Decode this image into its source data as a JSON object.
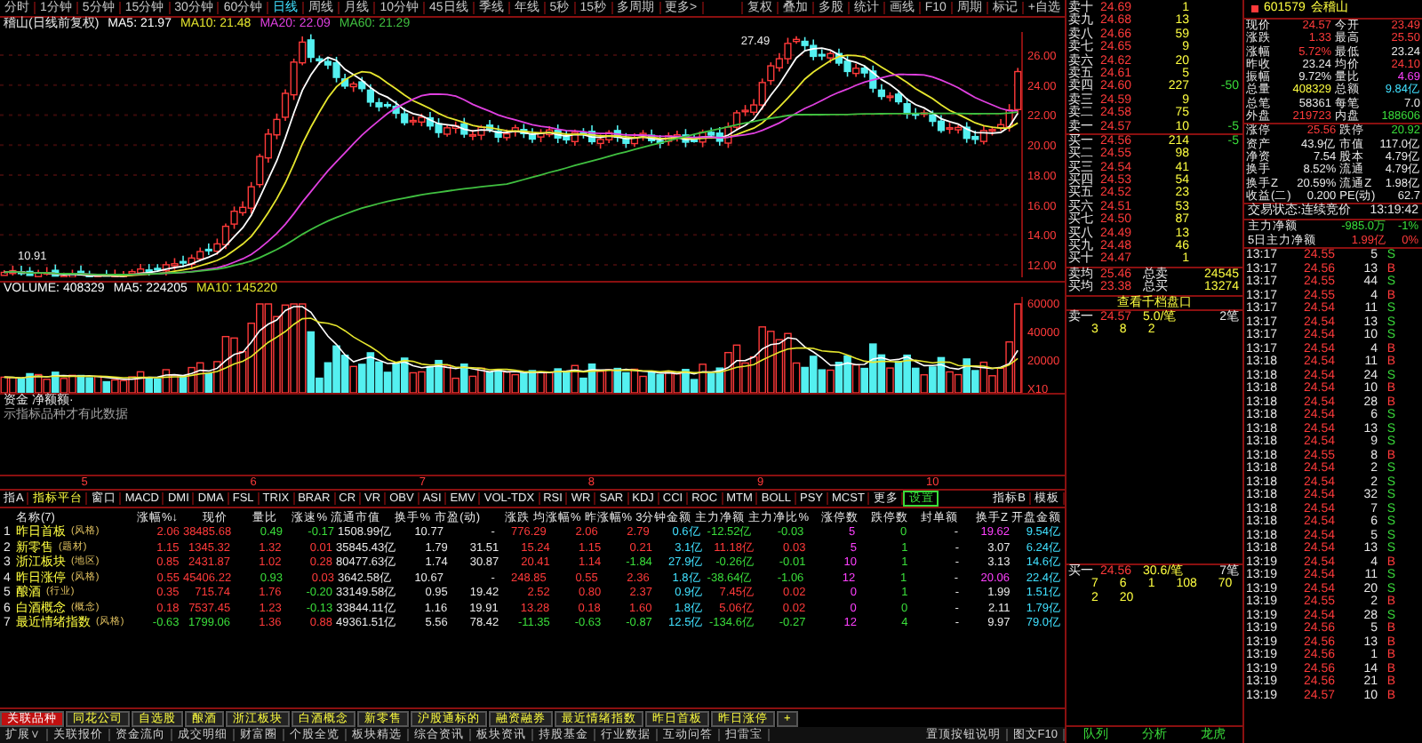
{
  "chart_toolbar": {
    "periods": [
      {
        "label": "分时",
        "selected": false
      },
      {
        "label": "1分钟",
        "selected": false
      },
      {
        "label": "5分钟",
        "selected": false
      },
      {
        "label": "15分钟",
        "selected": false
      },
      {
        "label": "30分钟",
        "selected": false
      },
      {
        "label": "60分钟",
        "selected": false
      },
      {
        "label": "日线",
        "selected": true
      },
      {
        "label": "周线",
        "selected": false
      },
      {
        "label": "月线",
        "selected": false
      },
      {
        "label": "10分钟",
        "selected": false
      },
      {
        "label": "45日线",
        "selected": false
      },
      {
        "label": "季线",
        "selected": false
      },
      {
        "label": "年线",
        "selected": false
      },
      {
        "label": "5秒",
        "selected": false
      },
      {
        "label": "15秒",
        "selected": false
      },
      {
        "label": "多周期",
        "selected": false
      },
      {
        "label": "更多>",
        "selected": false
      }
    ],
    "tools": [
      "复权",
      "叠加",
      "多股",
      "统计",
      "画线",
      "F10",
      "周期",
      "标记",
      "+自选"
    ]
  },
  "chart": {
    "title": "稽山(日线前复权)",
    "legend": [
      {
        "label": "MA5: 21.97",
        "color": "#ffffff"
      },
      {
        "label": "MA10: 21.48",
        "color": "#e6e62e"
      },
      {
        "label": "MA20: 22.09",
        "color": "#e040e0"
      },
      {
        "label": "MA60: 21.29",
        "color": "#40c040"
      }
    ],
    "high_label": "27.49",
    "low_label": "10.91",
    "price_ticks": [
      "26.00",
      "24.00",
      "22.00",
      "20.00",
      "18.00",
      "16.00",
      "14.00",
      "12.00"
    ]
  },
  "volume": {
    "legend": [
      {
        "label": "VOLUME: 408329",
        "color": "#ffffff"
      },
      {
        "label": "MA5: 224205",
        "color": "#ffffff"
      },
      {
        "label": "MA10: 145220",
        "color": "#e6e62e"
      }
    ],
    "ticks": [
      "60000",
      "40000",
      "20000",
      "X10"
    ]
  },
  "fund_panel": {
    "title": "资金 净额额·",
    "note": "示指标品种才有此数据"
  },
  "month_axis": [
    "5",
    "6",
    "7",
    "8",
    "9",
    "10"
  ],
  "indicator_tabs": [
    {
      "label": "指A",
      "kind": "plain",
      "selected": false
    },
    {
      "label": "指标平台",
      "kind": "accent",
      "selected": false
    },
    {
      "label": "窗口",
      "kind": "plain",
      "selected": false
    },
    {
      "label": "MACD",
      "kind": "plain",
      "selected": false
    },
    {
      "label": "DMI",
      "kind": "plain",
      "selected": false
    },
    {
      "label": "DMA",
      "kind": "plain",
      "selected": false
    },
    {
      "label": "FSL",
      "kind": "plain",
      "selected": false
    },
    {
      "label": "TRIX",
      "kind": "plain",
      "selected": false
    },
    {
      "label": "BRAR",
      "kind": "plain",
      "selected": false
    },
    {
      "label": "CR",
      "kind": "plain",
      "selected": false
    },
    {
      "label": "VR",
      "kind": "plain",
      "selected": false
    },
    {
      "label": "OBV",
      "kind": "plain",
      "selected": false
    },
    {
      "label": "ASI",
      "kind": "plain",
      "selected": false
    },
    {
      "label": "EMV",
      "kind": "plain",
      "selected": false
    },
    {
      "label": "VOL-TDX",
      "kind": "plain",
      "selected": false
    },
    {
      "label": "RSI",
      "kind": "plain",
      "selected": false
    },
    {
      "label": "WR",
      "kind": "plain",
      "selected": false
    },
    {
      "label": "SAR",
      "kind": "plain",
      "selected": false
    },
    {
      "label": "KDJ",
      "kind": "plain",
      "selected": false
    },
    {
      "label": "CCI",
      "kind": "plain",
      "selected": false
    },
    {
      "label": "ROC",
      "kind": "plain",
      "selected": false
    },
    {
      "label": "MTM",
      "kind": "plain",
      "selected": false
    },
    {
      "label": "BOLL",
      "kind": "plain",
      "selected": false
    },
    {
      "label": "PSY",
      "kind": "plain",
      "selected": false
    },
    {
      "label": "MCST",
      "kind": "plain",
      "selected": false
    },
    {
      "label": "更多",
      "kind": "plain",
      "selected": false
    },
    {
      "label": "设置",
      "kind": "plain",
      "selected": true
    }
  ],
  "indicator_right": [
    "指标B",
    "模板"
  ],
  "table": {
    "columns": [
      {
        "label": "名称(7)",
        "kind": "name"
      },
      {
        "label": "涨幅%↓",
        "kind": "sign"
      },
      {
        "label": "现价",
        "kind": "row"
      },
      {
        "label": "量比",
        "kind": "ratio"
      },
      {
        "label": "涨速%",
        "kind": "sign"
      },
      {
        "label": "流通市值",
        "kind": "plain"
      },
      {
        "label": "换手%",
        "kind": "plain"
      },
      {
        "label": "市盈(动)",
        "kind": "plain"
      },
      {
        "label": "涨跌",
        "kind": "sign"
      },
      {
        "label": "均涨幅%",
        "kind": "sign"
      },
      {
        "label": "昨涨幅%",
        "kind": "sign"
      },
      {
        "label": "3分钟金额",
        "kind": "amount"
      },
      {
        "label": "主力净额",
        "kind": "sign"
      },
      {
        "label": "主力净比%",
        "kind": "sign"
      },
      {
        "label": "涨停数",
        "kind": "limit_up"
      },
      {
        "label": "跌停数",
        "kind": "limit_down"
      },
      {
        "label": "封单额",
        "kind": "plain"
      },
      {
        "label": "换手Z",
        "kind": "turnover"
      },
      {
        "label": "开盘金额",
        "kind": "amount"
      }
    ],
    "rows": [
      {
        "index": "1",
        "tag": "(风格)",
        "cells": [
          "昨日首板",
          "2.06",
          "38485.68",
          "0.49",
          "-0.17",
          "1508.99亿",
          "10.77",
          "-",
          "776.29",
          "2.06",
          "2.79",
          "0.6亿",
          "-12.52亿",
          "-0.03",
          "5",
          "0",
          "-",
          "19.62",
          "9.54亿"
        ]
      },
      {
        "index": "2",
        "tag": "(题材)",
        "cells": [
          "新零售",
          "1.15",
          "1345.32",
          "1.32",
          "0.01",
          "35845.43亿",
          "1.79",
          "31.51",
          "15.24",
          "1.15",
          "0.21",
          "3.1亿",
          "11.18亿",
          "0.03",
          "5",
          "1",
          "-",
          "3.07",
          "6.24亿"
        ]
      },
      {
        "index": "3",
        "tag": "(地区)",
        "cells": [
          "浙江板块",
          "0.85",
          "2431.87",
          "1.02",
          "0.28",
          "80477.63亿",
          "1.74",
          "30.87",
          "20.41",
          "1.14",
          "-1.84",
          "27.9亿",
          "-0.26亿",
          "-0.01",
          "10",
          "1",
          "-",
          "3.13",
          "14.6亿"
        ]
      },
      {
        "index": "4",
        "tag": "(风格)",
        "cells": [
          "昨日涨停",
          "0.55",
          "45406.22",
          "0.93",
          "0.03",
          "3642.58亿",
          "10.67",
          "-",
          "248.85",
          "0.55",
          "2.36",
          "1.8亿",
          "-38.64亿",
          "-1.06",
          "12",
          "1",
          "-",
          "20.06",
          "22.4亿"
        ]
      },
      {
        "index": "5",
        "tag": "(行业)",
        "cells": [
          "酿酒",
          "0.35",
          "715.74",
          "1.76",
          "-0.20",
          "33149.58亿",
          "0.95",
          "19.42",
          "2.52",
          "0.80",
          "2.37",
          "0.9亿",
          "7.45亿",
          "0.02",
          "0",
          "1",
          "-",
          "1.99",
          "1.51亿"
        ]
      },
      {
        "index": "6",
        "tag": "(概念)",
        "cells": [
          "白酒概念",
          "0.18",
          "7537.45",
          "1.23",
          "-0.13",
          "33844.11亿",
          "1.16",
          "19.91",
          "13.28",
          "0.18",
          "1.60",
          "1.8亿",
          "5.06亿",
          "0.02",
          "0",
          "0",
          "-",
          "2.11",
          "1.79亿"
        ]
      },
      {
        "index": "7",
        "tag": "(风格)",
        "cells": [
          "最近情绪指数",
          "-0.63",
          "1799.06",
          "1.36",
          "0.88",
          "49361.51亿",
          "5.56",
          "78.42",
          "-11.35",
          "-0.63",
          "-0.87",
          "12.5亿",
          "-134.6亿",
          "-0.27",
          "12",
          "4",
          "-",
          "9.97",
          "79.0亿"
        ]
      }
    ]
  },
  "bottom_tabs": [
    {
      "label": "关联品种",
      "selected": true
    },
    {
      "label": "同花公司",
      "selected": false
    },
    {
      "label": "自选股",
      "selected": false
    },
    {
      "label": "酿酒",
      "selected": false
    },
    {
      "label": "浙江板块",
      "selected": false
    },
    {
      "label": "白酒概念",
      "selected": false
    },
    {
      "label": "新零售",
      "selected": false
    },
    {
      "label": "沪股通标的",
      "selected": false
    },
    {
      "label": "融资融券",
      "selected": false
    },
    {
      "label": "最近情绪指数",
      "selected": false
    },
    {
      "label": "昨日首板",
      "selected": false
    },
    {
      "label": "昨日涨停",
      "selected": false
    },
    {
      "label": "+",
      "selected": false
    }
  ],
  "status_bar": {
    "items": [
      "扩展∨",
      "关联报价",
      "资金流向",
      "成交明细",
      "财富圈",
      "个股全览",
      "板块精选",
      "综合资讯",
      "板块资讯",
      "持股基金",
      "行业数据",
      "互动问答",
      "扫雷宝"
    ],
    "right": [
      "置顶按钮说明",
      "图文F10"
    ]
  },
  "order_book": {
    "asks": [
      {
        "label": "卖十",
        "price": "24.69",
        "volume": "1"
      },
      {
        "label": "卖九",
        "price": "24.68",
        "volume": "13"
      },
      {
        "label": "卖八",
        "price": "24.66",
        "volume": "59"
      },
      {
        "label": "卖七",
        "price": "24.65",
        "volume": "9"
      },
      {
        "label": "卖六",
        "price": "24.62",
        "volume": "20"
      },
      {
        "label": "卖五",
        "price": "24.61",
        "volume": "5"
      },
      {
        "label": "卖四",
        "price": "24.60",
        "volume": "227",
        "change": "-50"
      },
      {
        "label": "卖三",
        "price": "24.59",
        "volume": "9"
      },
      {
        "label": "卖二",
        "price": "24.58",
        "volume": "75"
      },
      {
        "label": "卖一",
        "price": "24.57",
        "volume": "10",
        "change": "-5"
      }
    ],
    "bids": [
      {
        "label": "买一",
        "price": "24.56",
        "volume": "214",
        "change": "-5"
      },
      {
        "label": "买二",
        "price": "24.55",
        "volume": "98"
      },
      {
        "label": "买三",
        "price": "24.54",
        "volume": "41"
      },
      {
        "label": "买四",
        "price": "24.53",
        "volume": "54"
      },
      {
        "label": "买五",
        "price": "24.52",
        "volume": "23"
      },
      {
        "label": "买六",
        "price": "24.51",
        "volume": "53"
      },
      {
        "label": "买七",
        "price": "24.50",
        "volume": "87"
      },
      {
        "label": "买八",
        "price": "24.49",
        "volume": "13"
      },
      {
        "label": "买九",
        "price": "24.48",
        "volume": "46"
      },
      {
        "label": "买十",
        "price": "24.47",
        "volume": "1"
      }
    ],
    "averages": [
      {
        "label": "卖均",
        "price": "25.46",
        "total_label": "总卖",
        "total": "24545"
      },
      {
        "label": "买均",
        "price": "23.38",
        "total_label": "总买",
        "total": "13274"
      }
    ],
    "depth_link": "查看千档盘口",
    "ask_queue": {
      "label": "卖一",
      "price": "24.57",
      "per_order": "5.0/笔",
      "orders": "2笔",
      "lots": [
        "3",
        "8",
        "2"
      ]
    },
    "bid_queue": {
      "label": "买一",
      "price": "24.56",
      "per_order": "30.6/笔",
      "orders": "7笔",
      "lots": [
        "7",
        "6",
        "1",
        "108",
        "70",
        "2",
        "20"
      ]
    },
    "tabs": [
      "队列",
      "分析",
      "龙虎"
    ]
  },
  "quote": {
    "code": "601579",
    "name": "会稽山",
    "stats": [
      {
        "label": "现价",
        "value": "24.57",
        "color": "#ff3a3a"
      },
      {
        "label": "今开",
        "value": "23.49",
        "color": "#ff3a3a"
      },
      {
        "label": "涨跌",
        "value": "1.33",
        "color": "#ff3a3a"
      },
      {
        "label": "最高",
        "value": "25.50",
        "color": "#ff3a3a"
      },
      {
        "label": "涨幅",
        "value": "5.72%",
        "color": "#ff3a3a"
      },
      {
        "label": "最低",
        "value": "23.24",
        "color": "#e8e8e8"
      },
      {
        "label": "昨收",
        "value": "23.24",
        "color": "#e8e8e8"
      },
      {
        "label": "均价",
        "value": "24.10",
        "color": "#ff3a3a"
      },
      {
        "label": "振幅",
        "value": "9.72%",
        "color": "#e8e8e8"
      },
      {
        "label": "量比",
        "value": "4.69",
        "color": "#ff40ff"
      },
      {
        "label": "总量",
        "value": "408329",
        "color": "#ffff40"
      },
      {
        "label": "总额",
        "value": "9.84亿",
        "color": "#40e0ff"
      },
      {
        "label": "总笔",
        "value": "58361",
        "color": "#e8e8e8"
      },
      {
        "label": "每笔",
        "value": "7.0",
        "color": "#e8e8e8"
      },
      {
        "label": "外盘",
        "value": "219723",
        "color": "#ff3a3a"
      },
      {
        "label": "内盘",
        "value": "188606",
        "color": "#3adc3a"
      }
    ],
    "stats2": [
      {
        "label": "涨停",
        "value": "25.56",
        "color": "#ff3a3a"
      },
      {
        "label": "跌停",
        "value": "20.92",
        "color": "#3adc3a"
      },
      {
        "label": "资产",
        "value": "43.9亿",
        "color": "#e8e8e8"
      },
      {
        "label": "市值",
        "value": "117.0亿",
        "color": "#e8e8e8"
      },
      {
        "label": "净资",
        "value": "7.54",
        "color": "#e8e8e8"
      },
      {
        "label": "股本",
        "value": "4.79亿",
        "color": "#e8e8e8"
      },
      {
        "label": "换手",
        "value": "8.52%",
        "color": "#e8e8e8"
      },
      {
        "label": "流通",
        "value": "4.79亿",
        "color": "#e8e8e8"
      },
      {
        "label": "换手Z",
        "value": "20.59%",
        "color": "#e8e8e8"
      },
      {
        "label": "流通Z",
        "value": "1.98亿",
        "color": "#e8e8e8"
      },
      {
        "label": "收益(二)",
        "value": "0.200",
        "color": "#e8e8e8"
      },
      {
        "label": "PE(动)",
        "value": "62.7",
        "color": "#e8e8e8"
      }
    ],
    "status_label": "交易状态:连续竞价",
    "status_time": "13:19:42",
    "fund_flow": [
      {
        "label": "主力净额",
        "value": "-985.0万",
        "ratio": "-1%",
        "color": "#3adc3a"
      },
      {
        "label": "5日主力净额",
        "value": "1.99亿",
        "ratio": "0%",
        "color": "#ff3a3a"
      }
    ]
  },
  "ticks": [
    {
      "time": "13:17",
      "price": "24.55",
      "volume": "5",
      "side": "S",
      "buy": false
    },
    {
      "time": "13:17",
      "price": "24.56",
      "volume": "13",
      "side": "B",
      "buy": true
    },
    {
      "time": "13:17",
      "price": "24.55",
      "volume": "44",
      "side": "S",
      "buy": false
    },
    {
      "time": "13:17",
      "price": "24.55",
      "volume": "4",
      "side": "B",
      "buy": true
    },
    {
      "time": "13:17",
      "price": "24.54",
      "volume": "11",
      "side": "S",
      "buy": false
    },
    {
      "time": "13:17",
      "price": "24.54",
      "volume": "13",
      "side": "S",
      "buy": false
    },
    {
      "time": "13:17",
      "price": "24.54",
      "volume": "10",
      "side": "S",
      "buy": false
    },
    {
      "time": "13:17",
      "price": "24.54",
      "volume": "4",
      "side": "B",
      "buy": true
    },
    {
      "time": "13:18",
      "price": "24.54",
      "volume": "11",
      "side": "B",
      "buy": true
    },
    {
      "time": "13:18",
      "price": "24.54",
      "volume": "24",
      "side": "S",
      "buy": false
    },
    {
      "time": "13:18",
      "price": "24.54",
      "volume": "10",
      "side": "B",
      "buy": true
    },
    {
      "time": "13:18",
      "price": "24.54",
      "volume": "28",
      "side": "B",
      "buy": true
    },
    {
      "time": "13:18",
      "price": "24.54",
      "volume": "6",
      "side": "S",
      "buy": false
    },
    {
      "time": "13:18",
      "price": "24.54",
      "volume": "13",
      "side": "S",
      "buy": false
    },
    {
      "time": "13:18",
      "price": "24.54",
      "volume": "9",
      "side": "S",
      "buy": false
    },
    {
      "time": "13:18",
      "price": "24.55",
      "volume": "8",
      "side": "B",
      "buy": true
    },
    {
      "time": "13:18",
      "price": "24.54",
      "volume": "2",
      "side": "S",
      "buy": false
    },
    {
      "time": "13:18",
      "price": "24.54",
      "volume": "2",
      "side": "S",
      "buy": false
    },
    {
      "time": "13:18",
      "price": "24.54",
      "volume": "32",
      "side": "S",
      "buy": false
    },
    {
      "time": "13:18",
      "price": "24.54",
      "volume": "7",
      "side": "S",
      "buy": false
    },
    {
      "time": "13:18",
      "price": "24.54",
      "volume": "6",
      "side": "S",
      "buy": false
    },
    {
      "time": "13:18",
      "price": "24.54",
      "volume": "5",
      "side": "S",
      "buy": false
    },
    {
      "time": "13:18",
      "price": "24.54",
      "volume": "13",
      "side": "S",
      "buy": false
    },
    {
      "time": "13:19",
      "price": "24.54",
      "volume": "4",
      "side": "B",
      "buy": true
    },
    {
      "time": "13:19",
      "price": "24.54",
      "volume": "11",
      "side": "S",
      "buy": false
    },
    {
      "time": "13:19",
      "price": "24.54",
      "volume": "20",
      "side": "S",
      "buy": false
    },
    {
      "time": "13:19",
      "price": "24.55",
      "volume": "2",
      "side": "B",
      "buy": true
    },
    {
      "time": "13:19",
      "price": "24.54",
      "volume": "28",
      "side": "S",
      "buy": false
    },
    {
      "time": "13:19",
      "price": "24.56",
      "volume": "5",
      "side": "B",
      "buy": true
    },
    {
      "time": "13:19",
      "price": "24.56",
      "volume": "13",
      "side": "B",
      "buy": true
    },
    {
      "time": "13:19",
      "price": "24.56",
      "volume": "1",
      "side": "B",
      "buy": true
    },
    {
      "time": "13:19",
      "price": "24.56",
      "volume": "14",
      "side": "B",
      "buy": true
    },
    {
      "time": "13:19",
      "price": "24.56",
      "volume": "21",
      "side": "B",
      "buy": true
    },
    {
      "time": "13:19",
      "price": "24.57",
      "volume": "10",
      "side": "B",
      "buy": true
    }
  ]
}
